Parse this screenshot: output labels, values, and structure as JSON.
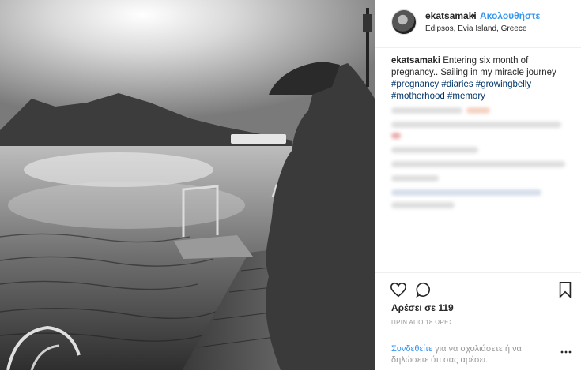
{
  "post": {
    "username": "ekatsamaki",
    "dot": "•",
    "follow_label": "Ακολουθήστε",
    "location": "Edipsos, Evia Island, Greece",
    "caption_user": "ekatsamaki",
    "caption_text": "Entering six month of pregnancy.. Sailing in my miracle journey",
    "hashtags": [
      "#pregnancy",
      "#diaries",
      "#growingbelly",
      "#motherhood",
      "#memory"
    ],
    "likes": "Αρέσει σε 119",
    "timestamp": "ΠΡΙΝ ΑΠΟ 18 ΩΡΕΣ",
    "login_link": "Συνδεθείτε",
    "login_text": "για να σχολιάσετε ή να δηλώσετε ότι σας αρέσει."
  },
  "icons": {
    "like": "heart-icon",
    "comment": "comment-icon",
    "save": "bookmark-icon",
    "more": "more-options-icon"
  },
  "colors": {
    "link": "#3897f0",
    "hashtag": "#003569",
    "text": "#262626",
    "muted": "#999999"
  }
}
